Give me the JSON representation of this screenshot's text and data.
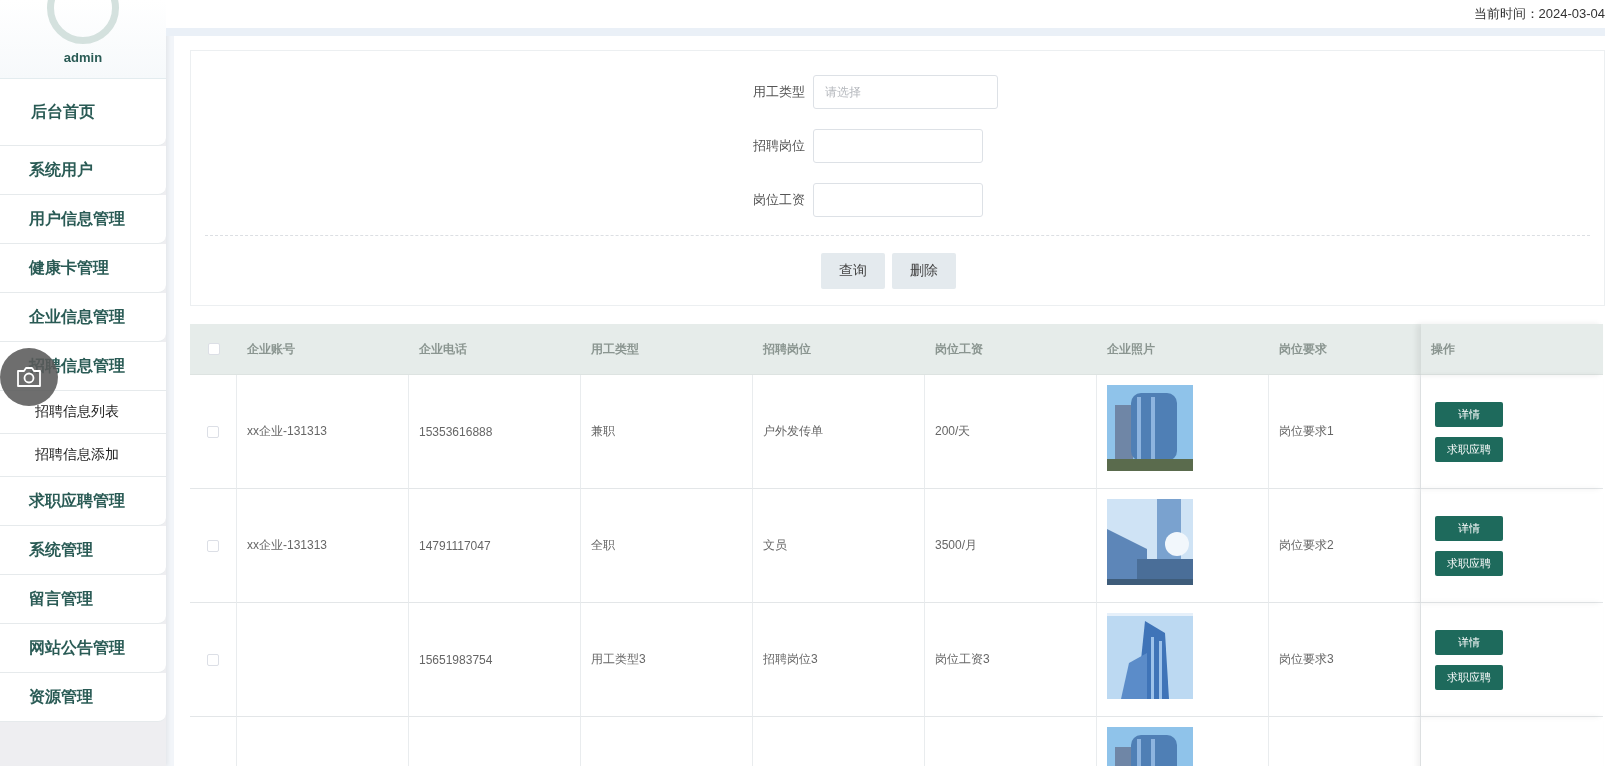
{
  "sidebar": {
    "user": {
      "name": "admin"
    },
    "items": [
      {
        "label": "后台首页",
        "expanded": false
      },
      {
        "label": "系统用户",
        "expanded": false
      },
      {
        "label": "用户信息管理",
        "expanded": false
      },
      {
        "label": "健康卡管理",
        "expanded": false
      },
      {
        "label": "企业信息管理",
        "expanded": false
      },
      {
        "label": "招聘信息管理",
        "expanded": true,
        "children": [
          {
            "label": "招聘信息列表"
          },
          {
            "label": "招聘信息添加"
          }
        ]
      },
      {
        "label": "求职应聘管理",
        "expanded": false
      },
      {
        "label": "系统管理",
        "expanded": false
      },
      {
        "label": "留言管理",
        "expanded": false
      },
      {
        "label": "网站公告管理",
        "expanded": false
      },
      {
        "label": "资源管理",
        "expanded": false
      }
    ]
  },
  "top_bar": {
    "current_time": "当前时间：2024-03-04"
  },
  "search_form": {
    "fields": [
      {
        "label": "用工类型",
        "kind": "select",
        "placeholder": "请选择"
      },
      {
        "label": "招聘岗位",
        "kind": "text"
      },
      {
        "label": "岗位工资",
        "kind": "text"
      }
    ],
    "buttons": [
      "查询",
      "删除"
    ]
  },
  "table": {
    "select_all": {
      "checked": false
    },
    "columns": [
      "企业账号",
      "企业电话",
      "用工类型",
      "招聘岗位",
      "岗位工资",
      "企业照片",
      "岗位要求",
      "操作"
    ],
    "rows": [
      {
        "checked": false,
        "cells": {
          "account": "xx企业-131313",
          "phone": "15353616888",
          "type": "兼职",
          "position": "户外发传单",
          "salary": "200/天"
        },
        "photo": {
          "kind": "picture"
        },
        "requirement": "岗位要求1",
        "actions": [
          "详情",
          "求职应聘"
        ]
      },
      {
        "checked": false,
        "cells": {
          "account": "xx企业-131313",
          "phone": "14791117047",
          "type": "全职",
          "position": "文员",
          "salary": "3500/月"
        },
        "photo": {
          "kind": "picture"
        },
        "requirement": "岗位要求2",
        "actions": [
          "详情",
          "求职应聘"
        ]
      },
      {
        "checked": false,
        "cells": {
          "phone": "15651983754",
          "type": "用工类型3",
          "position": "招聘岗位3",
          "salary": "岗位工资3"
        },
        "photo": {
          "kind": "picture"
        },
        "requirement": "岗位要求3",
        "actions": [
          "详情",
          "求职应聘"
        ]
      },
      {
        "photo": {
          "kind": "picture"
        }
      }
    ]
  },
  "screenshot_tool": {
    "kind": "camera"
  }
}
